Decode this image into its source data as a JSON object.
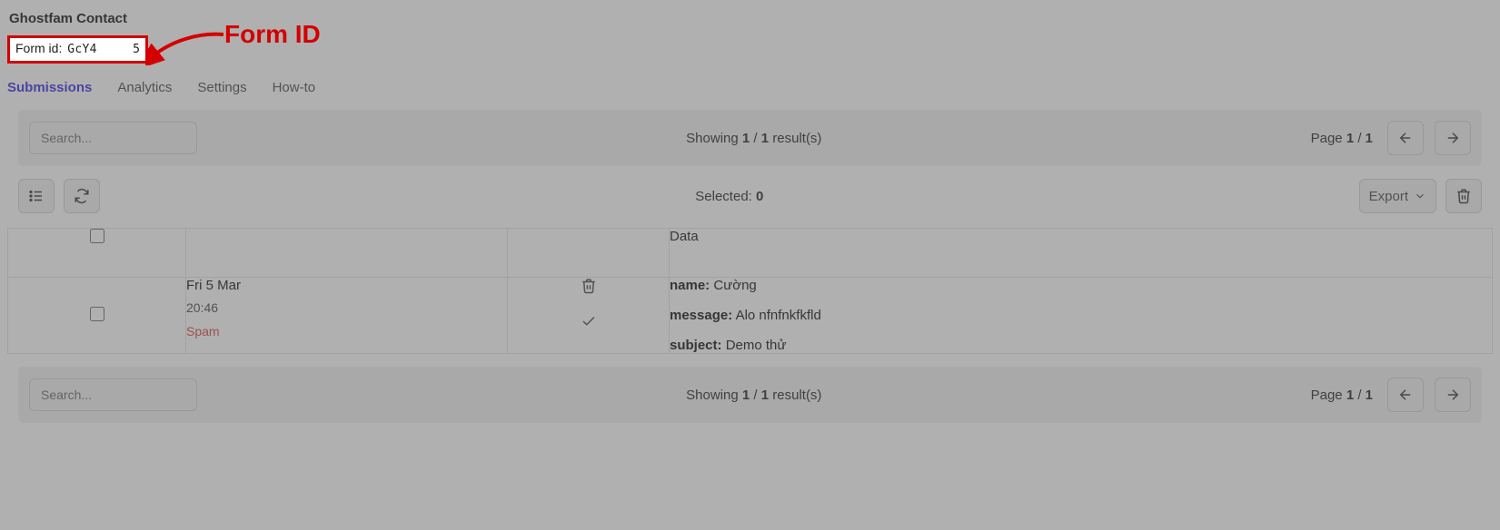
{
  "header": {
    "title": "Ghostfam Contact",
    "formIdLabel": "Form id:",
    "formIdValue": "GcY4",
    "formIdTail": "5"
  },
  "annotation": {
    "label": "Form ID"
  },
  "tabs": {
    "submissions": "Submissions",
    "analytics": "Analytics",
    "settings": "Settings",
    "howto": "How-to"
  },
  "search": {
    "placeholder": "Search..."
  },
  "pager": {
    "showingPrefix": "Showing ",
    "shown": "1",
    "sep": " / ",
    "total": "1",
    "resultsSuffix": " result(s)",
    "pageLabel": "Page ",
    "pageCurrent": "1",
    "pageTotal": "1"
  },
  "selection": {
    "label": "Selected: ",
    "count": "0",
    "exportLabel": "Export"
  },
  "table": {
    "headerData": "Data",
    "row": {
      "dateLine": "Fri 5 Mar",
      "timeLine": "20:46",
      "spamLabel": "Spam",
      "fields": {
        "nameLabel": "name:",
        "nameValue": "Cường",
        "messageLabel": "message:",
        "messageValue": "Alo nfnfnkfkfld",
        "subjectLabel": "subject:",
        "subjectValue": "Demo thử"
      }
    }
  }
}
